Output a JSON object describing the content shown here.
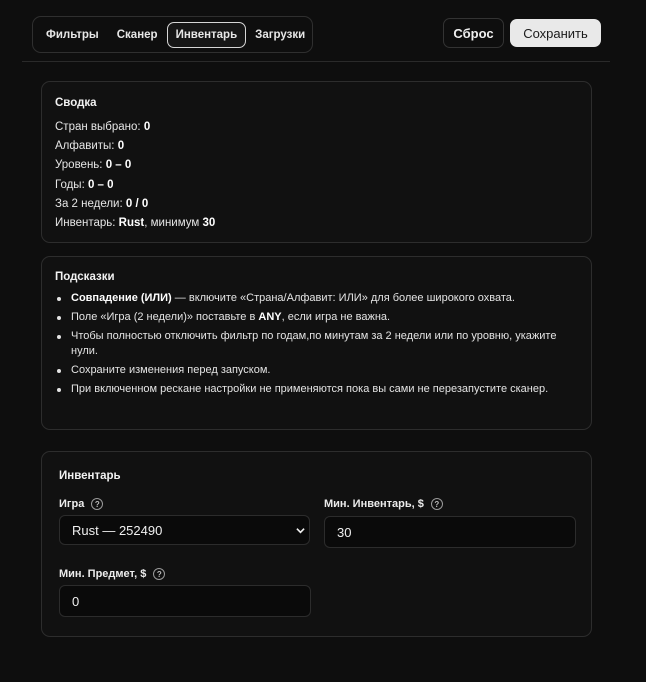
{
  "tabs": [
    "Фильтры",
    "Сканер",
    "Инвентарь",
    "Загрузки"
  ],
  "active_tab": "Инвентарь",
  "header": {
    "reset_label": "Сброс",
    "save_label": "Сохранить"
  },
  "summary": {
    "title": "Сводка",
    "lines": [
      {
        "label": "Стран выбрано: ",
        "value": "0",
        "suffix": ""
      },
      {
        "label": "Алфавиты: ",
        "value": "0",
        "suffix": ""
      },
      {
        "label": "Уровень: ",
        "value": "0 – 0",
        "suffix": ""
      },
      {
        "label": "Годы: ",
        "value": "0 – 0",
        "suffix": ""
      },
      {
        "label": "За 2 недели: ",
        "value": "0 / 0",
        "suffix": ""
      }
    ],
    "inventory_line": {
      "label": "Инвентарь: ",
      "game": "Rust",
      "mid": ", минимум ",
      "min": "30"
    }
  },
  "tips": {
    "title": "Подсказки",
    "item1": {
      "bold": "Совпадение (ИЛИ)",
      "rest": " — включите «Страна/Алфавит: ИЛИ» для более широкого охвата."
    },
    "item2": {
      "pre": "Поле «Игра (2 недели)» поставьте в ",
      "bold": "ANY",
      "post": ", если игра не важна."
    },
    "item3": "Чтобы полностью отключить фильтр по годам,по минутам за 2 недели или по уровню, укажите нули.",
    "item4": "Сохраните изменения перед запуском.",
    "item5": "При включенном рескане настройки не применяются пока вы сами не перезапустите сканер."
  },
  "inventory": {
    "title": "Инвентарь",
    "game_label": "Игра",
    "game_value": "Rust — 252490",
    "min_inventory_label": "Мин. Инвентарь, $",
    "min_inventory_value": "30",
    "min_item_label": "Мин. Предмет, $",
    "min_item_value": "0",
    "help_glyph": "?"
  }
}
